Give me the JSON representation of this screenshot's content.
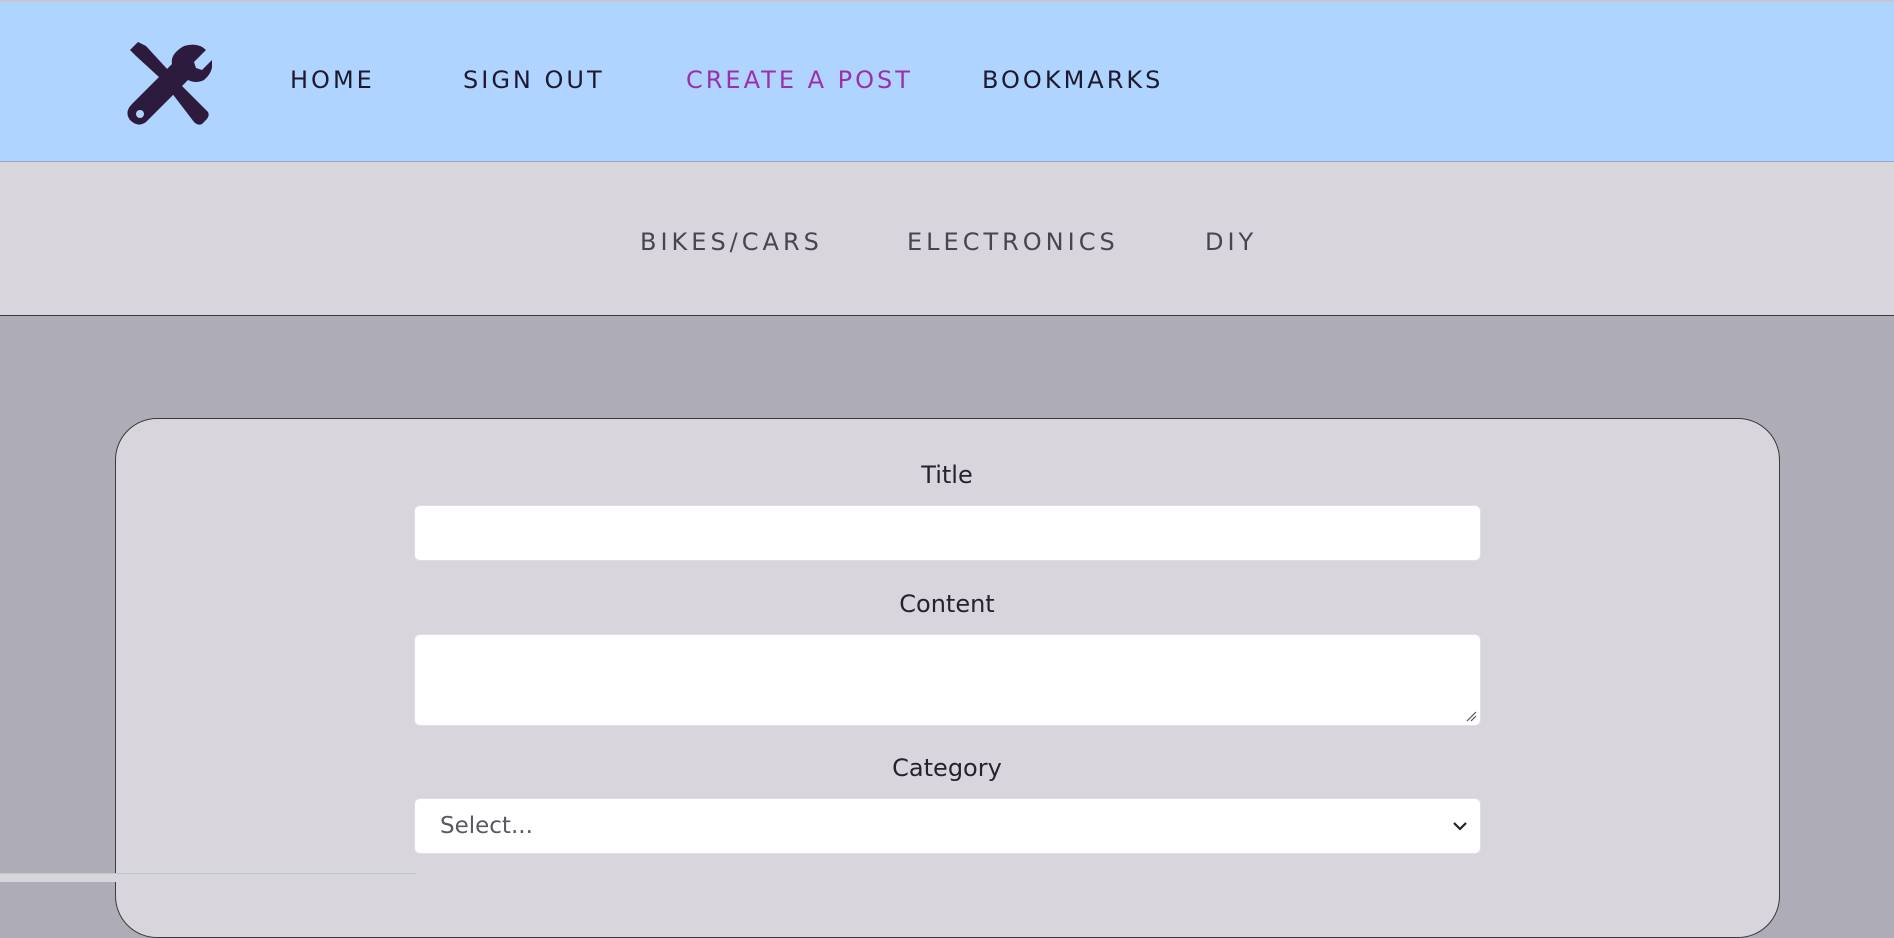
{
  "nav": {
    "logo_icon": "tools-icon",
    "links": [
      {
        "label": "HOME",
        "active": false
      },
      {
        "label": "SIGN OUT",
        "active": false
      },
      {
        "label": "CREATE A POST",
        "active": true
      },
      {
        "label": "BOOKMARKS",
        "active": false
      }
    ],
    "colors": {
      "background": "#aed4ff",
      "text": "#1e1a2e",
      "active": "#9b2fae"
    }
  },
  "categories": {
    "items": [
      "BIKES/CARS",
      "ELECTRONICS",
      "DIY"
    ],
    "background": "#d8d6dc"
  },
  "form": {
    "title_label": "Title",
    "title_value": "",
    "content_label": "Content",
    "content_value": "",
    "category_label": "Category",
    "category_selected": "Select..."
  },
  "page": {
    "background": "#adacb7",
    "card_background": "#d8d6dc"
  }
}
